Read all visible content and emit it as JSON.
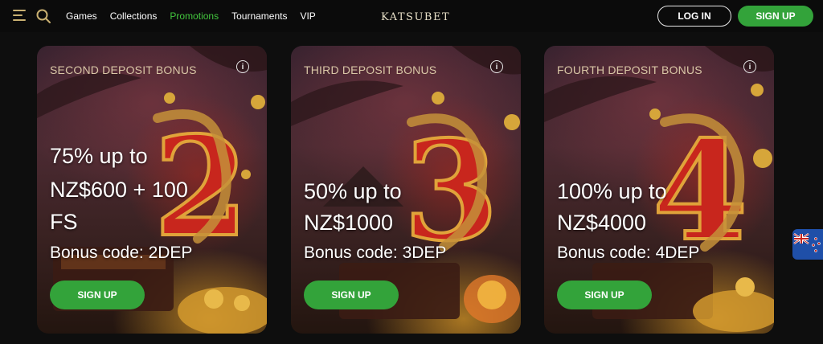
{
  "header": {
    "nav": [
      {
        "label": "Games",
        "active": false
      },
      {
        "label": "Collections",
        "active": false
      },
      {
        "label": "Promotions",
        "active": true
      },
      {
        "label": "Tournaments",
        "active": false
      },
      {
        "label": "VIP",
        "active": false
      }
    ],
    "logo": "KATSUBET",
    "login_label": "LOG IN",
    "signup_label": "SIGN UP"
  },
  "cards": [
    {
      "title": "SECOND DEPOSIT BONUS",
      "offer_line1": "75% up to",
      "offer_line2": "NZ$600 + 100",
      "offer_line3": "FS",
      "code": "Bonus code: 2DEP",
      "button": "SIGN UP",
      "numeral": "2"
    },
    {
      "title": "THIRD DEPOSIT BONUS",
      "offer_line1": "50% up to",
      "offer_line2": "NZ$1000",
      "code": "Bonus code: 3DEP",
      "button": "SIGN UP",
      "numeral": "3"
    },
    {
      "title": "FOURTH DEPOSIT BONUS",
      "offer_line1": "100% up to",
      "offer_line2": "NZ$4000",
      "code": "Bonus code: 4DEP",
      "button": "SIGN UP",
      "numeral": "4"
    }
  ],
  "colors": {
    "accent_green": "#33a33a",
    "active_nav": "#43c73e",
    "card_title": "#d9c6a6",
    "numeral_red": "#c8261d",
    "gold": "#d6a63a"
  },
  "icons": [
    "hamburger-menu-icon",
    "search-icon",
    "info-icon",
    "new-zealand-flag-icon"
  ]
}
